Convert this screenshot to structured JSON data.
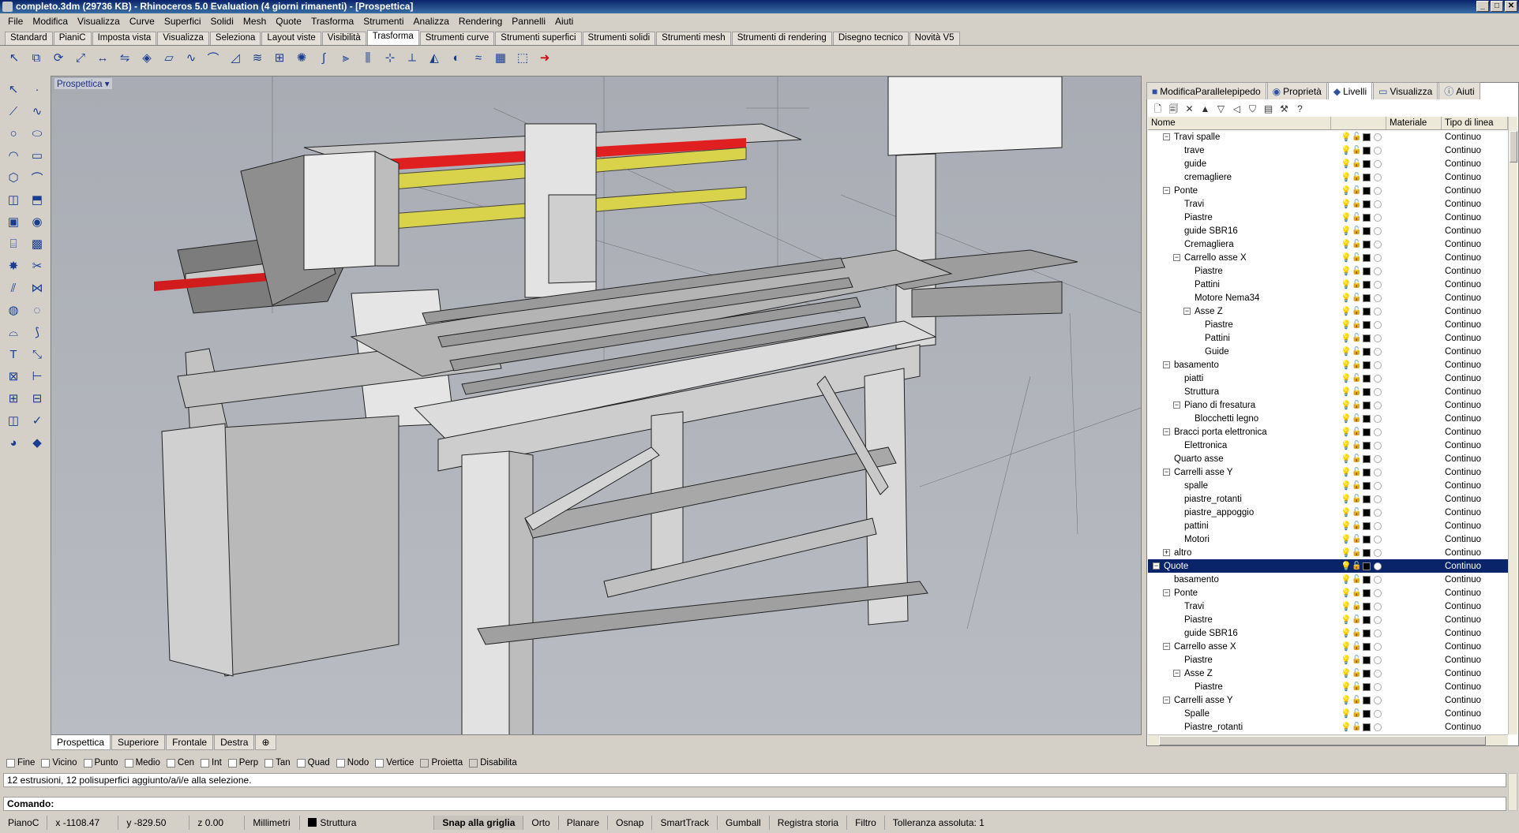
{
  "window": {
    "title": "completo.3dm (29736 KB) - Rhinoceros 5.0 Evaluation (4 giorni rimanenti) - [Prospettica]"
  },
  "menu": [
    "File",
    "Modifica",
    "Visualizza",
    "Curve",
    "Superfici",
    "Solidi",
    "Mesh",
    "Quote",
    "Trasforma",
    "Strumenti",
    "Analizza",
    "Rendering",
    "Pannelli",
    "Aiuti"
  ],
  "toolbar_tabs": [
    "Standard",
    "PianiC",
    "Imposta vista",
    "Visualizza",
    "Seleziona",
    "Layout viste",
    "Visibilità",
    "Trasforma",
    "Strumenti curve",
    "Strumenti superfici",
    "Strumenti solidi",
    "Strumenti mesh",
    "Strumenti di rendering",
    "Disegno tecnico",
    "Novità V5"
  ],
  "active_toolbar_tab": "Trasforma",
  "viewport": {
    "label": "Prospettica"
  },
  "viewport_tabs": [
    "Prospettica",
    "Superiore",
    "Frontale",
    "Destra"
  ],
  "panel": {
    "tabs": [
      "ModificaParallelepipedo",
      "Proprietà",
      "Livelli",
      "Visualizza",
      "Aiuti"
    ],
    "active_tab": "Livelli",
    "columns": {
      "name": "Nome",
      "material": "Materiale",
      "linetype": "Tipo di linea"
    },
    "layers": [
      {
        "name": "Travi spalle",
        "toggle": "−",
        "lt": "Continuo"
      },
      {
        "name": "trave",
        "lt": "Continuo"
      },
      {
        "name": "guide",
        "lt": "Continuo"
      },
      {
        "name": "cremagliere",
        "lt": "Continuo"
      },
      {
        "name": "Ponte",
        "toggle": "−",
        "lt": "Continuo"
      },
      {
        "name": "Travi",
        "lt": "Continuo"
      },
      {
        "name": "Piastre",
        "lt": "Continuo"
      },
      {
        "name": "guide SBR16",
        "lt": "Continuo"
      },
      {
        "name": "Cremagliera",
        "lt": "Continuo"
      },
      {
        "name": "Carrello asse X",
        "toggle": "−",
        "lt": "Continuo"
      },
      {
        "name": "Piastre",
        "lt": "Continuo"
      },
      {
        "name": "Pattini",
        "lt": "Continuo"
      },
      {
        "name": "Motore Nema34",
        "lt": "Continuo"
      },
      {
        "name": "Asse Z",
        "toggle": "−",
        "lt": "Continuo"
      },
      {
        "name": "Piastre",
        "lt": "Continuo"
      },
      {
        "name": "Pattini",
        "lt": "Continuo"
      },
      {
        "name": "Guide",
        "lt": "Continuo"
      },
      {
        "name": "basamento",
        "toggle": "−",
        "lt": "Continuo"
      },
      {
        "name": "piatti",
        "lt": "Continuo"
      },
      {
        "name": "Struttura",
        "lt": "Continuo"
      },
      {
        "name": "Piano di fresatura",
        "toggle": "−",
        "lt": "Continuo"
      },
      {
        "name": "Blocchetti legno",
        "lt": "Continuo"
      },
      {
        "name": "Bracci porta elettronica",
        "toggle": "−",
        "lt": "Continuo"
      },
      {
        "name": "Elettronica",
        "lt": "Continuo"
      },
      {
        "name": "Quarto asse",
        "lt": "Continuo"
      },
      {
        "name": "Carrelli asse Y",
        "toggle": "−",
        "lt": "Continuo"
      },
      {
        "name": "spalle",
        "lt": "Continuo"
      },
      {
        "name": "piastre_rotanti",
        "lt": "Continuo"
      },
      {
        "name": "piastre_appoggio",
        "lt": "Continuo"
      },
      {
        "name": "pattini",
        "lt": "Continuo"
      },
      {
        "name": "Motori",
        "lt": "Continuo"
      },
      {
        "name": "altro",
        "toggle": "+",
        "lt": "Continuo"
      },
      {
        "name": "Quote",
        "toggle": "−",
        "lt": "Continuo",
        "selected": true
      },
      {
        "name": "basamento",
        "lt": "Continuo"
      },
      {
        "name": "Ponte",
        "toggle": "−",
        "lt": "Continuo"
      },
      {
        "name": "Travi",
        "lt": "Continuo"
      },
      {
        "name": "Piastre",
        "lt": "Continuo"
      },
      {
        "name": "guide SBR16",
        "lt": "Continuo"
      },
      {
        "name": "Carrello asse X",
        "toggle": "−",
        "lt": "Continuo"
      },
      {
        "name": "Piastre",
        "lt": "Continuo"
      },
      {
        "name": "Asse Z",
        "toggle": "−",
        "lt": "Continuo"
      },
      {
        "name": "Piastre",
        "lt": "Continuo"
      },
      {
        "name": "Carrelli asse Y",
        "toggle": "−",
        "lt": "Continuo"
      },
      {
        "name": "Spalle",
        "lt": "Continuo"
      },
      {
        "name": "Piastre_rotanti",
        "lt": "Continuo"
      }
    ]
  },
  "osnaps": [
    "Fine",
    "Vicino",
    "Punto",
    "Medio",
    "Cen",
    "Int",
    "Perp",
    "Tan",
    "Quad",
    "Nodo",
    "Vertice",
    "Proietta",
    "Disabilita"
  ],
  "command": {
    "history": "12 estrusioni, 12 polisuperfici aggiunto/a/i/e alla selezione.",
    "prompt": "Comando:"
  },
  "status": {
    "cplane": "PianoC",
    "x": "x -1108.47",
    "y": "y -829.50",
    "z": "z 0.00",
    "units": "Millimetri",
    "layer": "Struttura",
    "grid_snap": "Snap alla griglia",
    "ortho": "Orto",
    "planar": "Planare",
    "osnap": "Osnap",
    "smarttrack": "SmartTrack",
    "gumball": "Gumball",
    "history": "Registra storia",
    "filter": "Filtro",
    "tolerance": "Tolleranza assoluta: 1"
  }
}
